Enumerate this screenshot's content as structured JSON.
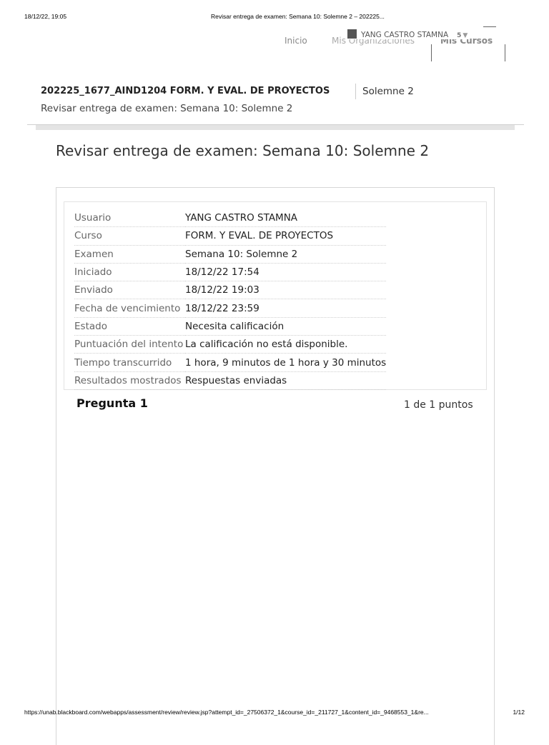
{
  "print": {
    "date": "18/12/22, 19:05",
    "doc_title": "Revisar entrega de examen: Semana 10: Solemne 2 – 202225...",
    "url": "https://unab.blackboard.com/webapps/assessment/review/review.jsp?attempt_id=_27506372_1&course_id=_211727_1&content_id=_9468553_1&re...",
    "page": "1/12"
  },
  "nav": {
    "inicio": "Inicio",
    "organizaciones": "Mis Organizaciones",
    "cursos": "Mis Cursos",
    "user_name": "YANG CASTRO STAMNA",
    "notif_count": "5"
  },
  "course": {
    "title": "202225_1677_AIND1204 FORM. Y EVAL. DE PROYECTOS",
    "section": "Solemne 2",
    "breadcrumb": "Revisar entrega de examen: Semana 10: Solemne 2"
  },
  "page_title": "Revisar entrega de examen: Semana 10: Solemne 2",
  "info": [
    {
      "label": "Usuario",
      "value": "YANG CASTRO STAMNA"
    },
    {
      "label": "Curso",
      "value": "FORM. Y EVAL. DE PROYECTOS"
    },
    {
      "label": "Examen",
      "value": "Semana 10: Solemne 2"
    },
    {
      "label": "Iniciado",
      "value": "18/12/22 17:54"
    },
    {
      "label": "Enviado",
      "value": "18/12/22 19:03"
    },
    {
      "label": "Fecha de vencimiento",
      "value": "18/12/22 23:59"
    },
    {
      "label": "Estado",
      "value": "Necesita calificación"
    },
    {
      "label": "Puntuación del intento",
      "value": "La calificación no está disponible."
    },
    {
      "label": "Tiempo transcurrido",
      "value": "1 hora, 9 minutos de 1 hora y 30 minutos"
    },
    {
      "label": "Resultados mostrados",
      "value": "Respuestas enviadas"
    }
  ],
  "question": {
    "title": "Pregunta 1",
    "points": "1 de 1 puntos"
  }
}
